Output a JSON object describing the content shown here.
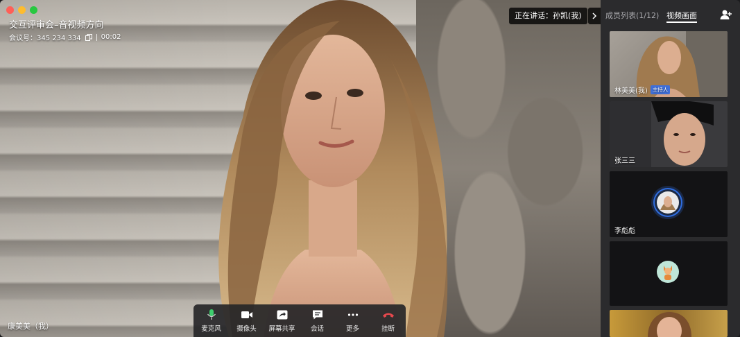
{
  "window": {
    "traffic_lights": {
      "close": "#ff5f57",
      "minimize": "#febc2e",
      "zoom": "#28c840"
    }
  },
  "meeting": {
    "title": "交互评审会–音视频方向",
    "id_label": "会议号：345 234 334",
    "duration": "00:02"
  },
  "speaking": {
    "label": "正在讲话：孙凯(我)"
  },
  "local_user": {
    "name": "康美美（我）"
  },
  "toolbar": {
    "mic": "麦克风",
    "camera": "摄像头",
    "share": "屏幕共享",
    "chat": "会话",
    "more": "更多",
    "hangup": "挂断"
  },
  "panel": {
    "tab_members": "成员列表(1/12)",
    "tab_video": "视频画面",
    "tiles": [
      {
        "name": "林美美(我)",
        "badge": "主持人"
      },
      {
        "name": "张三三"
      },
      {
        "name": "李彪彪"
      },
      {
        "name": ""
      },
      {
        "name": ""
      }
    ]
  },
  "colors": {
    "accent": "#3f6fd9",
    "hangup": "#e5484d",
    "mic": "#3ecf6e"
  }
}
